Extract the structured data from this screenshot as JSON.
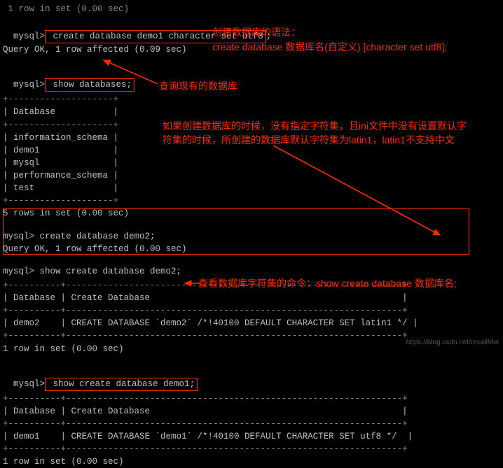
{
  "top_fragment": " 1 row in set (0.00 sec)",
  "cmd1": {
    "prompt": "mysql>",
    "sql": " create database demo1 character set utf8",
    "tail": ";"
  },
  "line2": "Query OK, 1 row affected (0.09 sec)",
  "cmd2": {
    "prompt": "mysql>",
    "sql": " show databases;"
  },
  "db_table": {
    "border_top": "+--------------------+",
    "header": "| Database           |",
    "border_mid": "+--------------------+",
    "rows": [
      "| information_schema |",
      "| demo1              |",
      "| mysql              |",
      "| performance_schema |",
      "| test               |"
    ],
    "border_bot": "+--------------------+",
    "summary": "5 rows in set (0.00 sec)"
  },
  "cmd3": "mysql> create database demo2;",
  "line_cmd3_result": "Query OK, 1 row affected (0.00 sec)",
  "cmd4": "mysql> show create database demo2;",
  "demo2_table": {
    "border": "+----------+----------------------------------------------------------------+",
    "header": "| Database | Create Database                                                |",
    "row": "| demo2    | CREATE DATABASE `demo2` /*!40100 DEFAULT CHARACTER SET latin1 */ |",
    "summary": "1 row in set (0.00 sec)"
  },
  "cmd5": {
    "prompt": "mysql>",
    "sql": " show create database demo1;"
  },
  "demo1_table": {
    "border": "+----------+----------------------------------------------------------------+",
    "header": "| Database | Create Database                                                |",
    "row": "| demo1    | CREATE DATABASE `demo1` /*!40100 DEFAULT CHARACTER SET utf8 */  |",
    "summary": "1 row in set (0.00 sec)"
  },
  "anno": {
    "a1_l1": "创建数据库的语法：",
    "a1_l2": "create database 数据库名(自定义) [character set utf8];",
    "a2": "查询现有的数据库",
    "a3_l1": "如果创建数据库的时候，没有指定字符集，且ini文件中没有设置默认字",
    "a3_l2": "符集的时候，所创建的数据库默认字符集为latin1，latin1不支持中文",
    "a4": "查看数据库字符集的命令：show create database 数据库名;"
  },
  "watermark": "https://blog.csdn.net/recallMei"
}
